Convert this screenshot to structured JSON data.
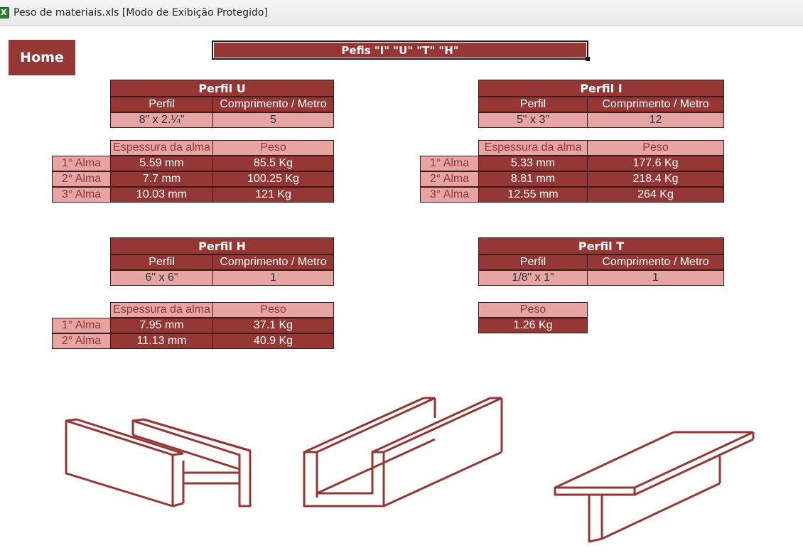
{
  "window": {
    "title": "Peso de materiais.xls  [Modo de Exibição Protegido]"
  },
  "home_label": "Home",
  "main_header": "Pefis \"I\" \"U\" \"T\" \"H\"",
  "perfil_u": {
    "title": "Perfil U",
    "col_perfil": "Perfil",
    "col_comprimento": "Comprimento / Metro",
    "perfil_value": "8\" x 2.¼\"",
    "comprimento_value": "5",
    "col_espessura": "Espessura da alma",
    "col_peso": "Peso",
    "rows": [
      {
        "label": "1° Alma",
        "espessura": "5.59 mm",
        "peso": "85.5 Kg"
      },
      {
        "label": "2° Alma",
        "espessura": "7.7 mm",
        "peso": "100.25 Kg"
      },
      {
        "label": "3° Alma",
        "espessura": "10.03 mm",
        "peso": "121 Kg"
      }
    ]
  },
  "perfil_i": {
    "title": "Perfil I",
    "col_perfil": "Perfil",
    "col_comprimento": "Comprimento / Metro",
    "perfil_value": "5\" x 3\"",
    "comprimento_value": "12",
    "col_espessura": "Espessura da alma",
    "col_peso": "Peso",
    "rows": [
      {
        "label": "1° Alma",
        "espessura": "5.33 mm",
        "peso": "177.6 Kg"
      },
      {
        "label": "2° Alma",
        "espessura": "8.81 mm",
        "peso": "218.4 Kg"
      },
      {
        "label": "3° Alma",
        "espessura": "12.55 mm",
        "peso": "264 Kg"
      }
    ]
  },
  "perfil_h": {
    "title": "Perfil H",
    "col_perfil": "Perfil",
    "col_comprimento": "Comprimento / Metro",
    "perfil_value": "6\" x 6\"",
    "comprimento_value": "1",
    "col_espessura": "Espessura da alma",
    "col_peso": "Peso",
    "rows": [
      {
        "label": "1° Alma",
        "espessura": "7.95 mm",
        "peso": "37.1 Kg"
      },
      {
        "label": "2° Alma",
        "espessura": "11.13 mm",
        "peso": "40.9 Kg"
      }
    ]
  },
  "perfil_t": {
    "title": "Perfil T",
    "col_perfil": "Perfil",
    "col_comprimento": "Comprimento / Metro",
    "perfil_value": "1/8\" x 1\"",
    "comprimento_value": "1",
    "col_peso": "Peso",
    "peso_value": "1.26 Kg"
  },
  "colors": {
    "dark_red": "#953735",
    "light_pink": "#e6a4a3",
    "drawing_stroke": "#953735"
  },
  "icons": [
    "excel-file-icon"
  ]
}
